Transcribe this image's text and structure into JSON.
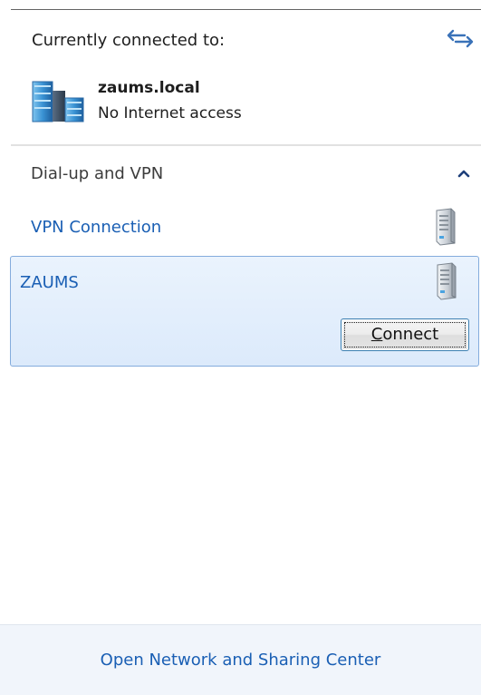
{
  "connection": {
    "heading": "Currently connected to:",
    "network_name": "zaums.local",
    "network_status": "No Internet access",
    "refresh_icon": "refresh-arrows-icon",
    "network_icon": "network-buildings-icon"
  },
  "dialup_section": {
    "label": "Dial-up and VPN",
    "chevron_icon": "chevron-up-icon",
    "expanded": true,
    "items": [
      {
        "label": "VPN Connection",
        "icon": "vpn-server-icon",
        "selected": false
      },
      {
        "label": "ZAUMS",
        "icon": "vpn-server-icon",
        "selected": true,
        "action_label": "Connect",
        "action_accelerator": "C",
        "action_rest": "onnect"
      }
    ]
  },
  "footer": {
    "link_label": "Open Network and Sharing Center"
  },
  "colors": {
    "link": "#1a5fb4",
    "selection_border": "#84acdd",
    "selection_fill": "#e3effc",
    "footer_bg": "#f1f5fb"
  }
}
